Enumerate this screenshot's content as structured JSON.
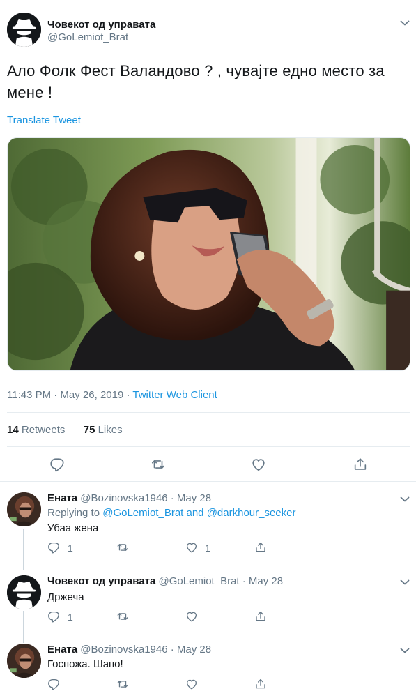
{
  "main_tweet": {
    "author_name": "Човекот од управата",
    "author_handle": "@GoLemiot_Brat",
    "text": "Ало Фолк Фест Валандово ? , чувајте едно место за мене !",
    "translate_label": "Translate Tweet",
    "timestamp": "11:43 PM · May 26, 2019 · ",
    "client": "Twitter Web Client",
    "retweets_count": "14",
    "retweets_label": "Retweets",
    "likes_count": "75",
    "likes_label": "Likes"
  },
  "replies": [
    {
      "author_name": "Ената",
      "author_handle": "@Bozinovska1946 · May 28",
      "replying_prefix": "Replying to ",
      "replying_users": "@GoLemiot_Brat and @darkhour_seeker",
      "text": "Убаа жена",
      "reply_count": "1",
      "retweet_count": "",
      "like_count": "1"
    },
    {
      "author_name": "Човекот од управата",
      "author_handle": "@GoLemiot_Brat · May 28",
      "text": "Држеча",
      "reply_count": "1",
      "retweet_count": "",
      "like_count": ""
    },
    {
      "author_name": "Ената",
      "author_handle": "@Bozinovska1946 · May 28",
      "text": "Госпожа. Шапо!",
      "reply_count": "",
      "retweet_count": "",
      "like_count": ""
    }
  ],
  "icons": {
    "reply": "reply-icon",
    "retweet": "retweet-icon",
    "like": "heart-icon",
    "share": "share-icon",
    "more": "chevron-down-icon"
  },
  "colors": {
    "link": "#1b95e0",
    "secondary_text": "#657786",
    "primary_text": "#14171a",
    "divider": "#e6ecf0"
  }
}
